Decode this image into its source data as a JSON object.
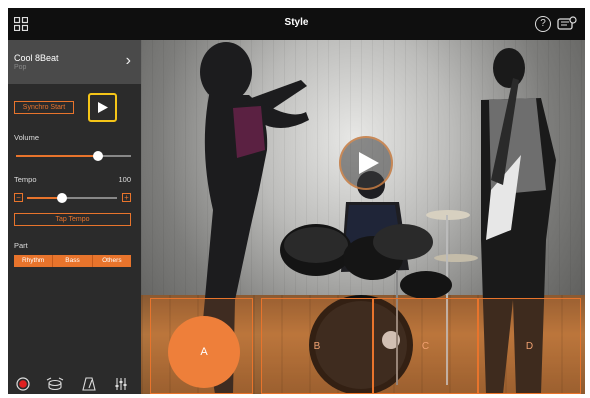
{
  "header": {
    "title": "Style"
  },
  "style": {
    "name": "Cool 8Beat",
    "genre": "Pop"
  },
  "controls": {
    "synchro_start": "Synchro Start",
    "volume_label": "Volume",
    "volume_level": 0.75,
    "tempo_label": "Tempo",
    "tempo_value": "100",
    "tempo_level": 0.35,
    "minus": "−",
    "plus": "+",
    "tap_tempo": "Tap Tempo",
    "part_label": "Part",
    "parts": [
      "Rhythm",
      "Bass",
      "Others"
    ]
  },
  "pads": [
    "A",
    "B",
    "C",
    "D"
  ],
  "colors": {
    "accent": "#e8742c",
    "highlight": "#f5c518",
    "sidebar": "#2b2b2b"
  },
  "icons": [
    "menu-grid-icon",
    "help-icon",
    "settings-icon",
    "chevron-right-icon",
    "play-icon",
    "record-icon",
    "drum-icon",
    "metronome-icon",
    "mixer-icon"
  ]
}
